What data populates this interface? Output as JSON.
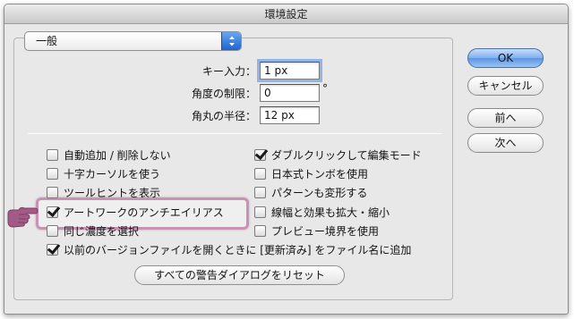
{
  "window": {
    "title": "環境設定"
  },
  "category_popup": {
    "selected": "一般"
  },
  "fields": {
    "key_increment": {
      "label": "キー入力：",
      "value": "1 px"
    },
    "constrain_angle": {
      "label": "角度の制限：",
      "value": "0",
      "unit": "°"
    },
    "corner_radius": {
      "label": "角丸の半径：",
      "value": "12 px"
    }
  },
  "options": {
    "auto_add_delete": {
      "label": "自動追加 / 削除しない",
      "checked": false
    },
    "precise_cursors": {
      "label": "十字カーソルを使う",
      "checked": false
    },
    "show_tool_tips": {
      "label": "ツールヒントを表示",
      "checked": false
    },
    "anti_aliased_artwork": {
      "label": "アートワークのアンチエイリアス",
      "checked": true
    },
    "select_same_tint": {
      "label": "同じ濃度を選択",
      "checked": false
    },
    "legacy_file_names": {
      "label": "以前のバージョンファイルを開くときに [更新済み] をファイル名に追加",
      "checked": true
    },
    "double_click_isolate": {
      "label": "ダブルクリックして編集モード",
      "checked": true
    },
    "japanese_crop_marks": {
      "label": "日本式トンボを使用",
      "checked": false
    },
    "transform_patterns": {
      "label": "パターンも変形する",
      "checked": false
    },
    "scale_strokes": {
      "label": "線幅と効果も拡大・縮小",
      "checked": false
    },
    "preview_bounds": {
      "label": "プレビュー境界を使用",
      "checked": false
    }
  },
  "reset_warnings_label": "すべての警告ダイアログをリセット",
  "buttons": {
    "ok": "OK",
    "cancel": "キャンセル",
    "previous": "前へ",
    "next": "次へ"
  },
  "colors": {
    "highlight_border": "#c693b3",
    "hand_pointer": "#a35a86",
    "default_button": "#5a95e6"
  },
  "icons": {
    "stepper": "popup-stepper-arrows",
    "pointer": "pointing-hand"
  }
}
